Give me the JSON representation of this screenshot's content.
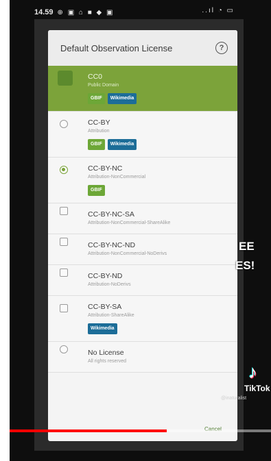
{
  "status_bar": {
    "time": "14.59",
    "left_icons": "⊕ ▣ ⌂ ■ ◆ ▣",
    "right_icons": "..ıl ◔ ▭"
  },
  "dialog": {
    "title": "Default Observation License",
    "help_icon": "?"
  },
  "licenses": [
    {
      "name": "CC0",
      "desc": "Public Domain",
      "badges": [
        "GBIF",
        "Wikimedia"
      ],
      "selected": true,
      "radio": "large"
    },
    {
      "name": "CC-BY",
      "desc": "Attribution",
      "badges": [
        "GBIF",
        "Wikimedia"
      ],
      "selected": false,
      "radio": "circle"
    },
    {
      "name": "CC-BY-NC",
      "desc": "Attribution-NonCommercial",
      "badges": [
        "GBIF"
      ],
      "selected": false,
      "radio": "checked"
    },
    {
      "name": "CC-BY-NC-SA",
      "desc": "Attribution-NonCommercial-ShareAlike",
      "badges": [],
      "selected": false,
      "radio": "square"
    },
    {
      "name": "CC-BY-NC-ND",
      "desc": "Attribution-NonCommercial-NoDerivs",
      "badges": [],
      "selected": false,
      "radio": "square"
    },
    {
      "name": "CC-BY-ND",
      "desc": "Attribution-NoDerivs",
      "badges": [],
      "selected": false,
      "radio": "square"
    },
    {
      "name": "CC-BY-SA",
      "desc": "Attribution-ShareAlike",
      "badges": [
        "Wikimedia"
      ],
      "selected": false,
      "radio": "square"
    },
    {
      "name": "No License",
      "desc": "All rights reserved",
      "badges": [],
      "selected": false,
      "radio": "circle"
    }
  ],
  "overlay": {
    "line1": "EE",
    "line2": "ES!"
  },
  "tiktok": {
    "logo": "♪",
    "name": "TikTok",
    "user": "@inaturalist"
  },
  "player": {
    "progress": 0.6,
    "ok_label": "Cancel"
  },
  "colors": {
    "accent_green": "#7ca33a",
    "gbif_badge": "#6da737",
    "wikimedia_badge": "#1c6d98",
    "progress_red": "#ff0000"
  }
}
